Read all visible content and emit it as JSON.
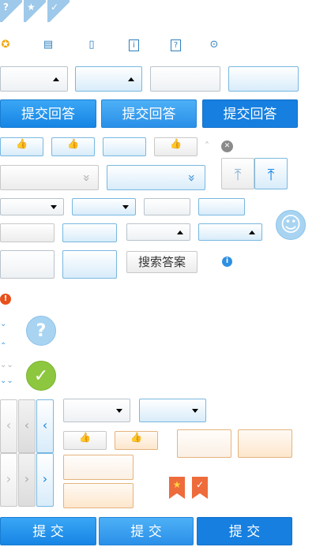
{
  "colors": {
    "accent": "#1685e4",
    "light_blue": "#d8ecfa",
    "orange": "#e5b37e",
    "green": "#8dc73f",
    "red": "#e8501c"
  },
  "flags": [
    {
      "icon": "question-icon",
      "glyph": "?"
    },
    {
      "icon": "star-icon",
      "glyph": "★"
    },
    {
      "icon": "check-icon",
      "glyph": "✓"
    }
  ],
  "small_icons": [
    {
      "icon": "medal-icon",
      "glyph": "✪"
    },
    {
      "icon": "database-icon",
      "glyph": "▤"
    },
    {
      "icon": "phone-icon",
      "glyph": "▯"
    },
    {
      "icon": "info-icon",
      "glyph": "i"
    },
    {
      "icon": "question-box-icon",
      "glyph": "?"
    },
    {
      "icon": "search-circle-icon",
      "glyph": "⊙"
    }
  ],
  "submit_answer_label": "提交回答",
  "search_answer_label": "搜索答案",
  "submit_label": "提 交",
  "thumb_glyph": "👍",
  "up_glyph": "⤒",
  "close_glyph": "✕",
  "info_glyph": "i",
  "alert_glyph": "!",
  "question_glyph": "?",
  "check_glyph": "✓",
  "smile_glyph": "☺",
  "caret_up_glyph": "˄",
  "double_down_glyph": "»",
  "nav_left_glyph": "‹",
  "nav_right_glyph": "›",
  "bookmark_star_glyph": "★",
  "bookmark_check_glyph": "✓"
}
